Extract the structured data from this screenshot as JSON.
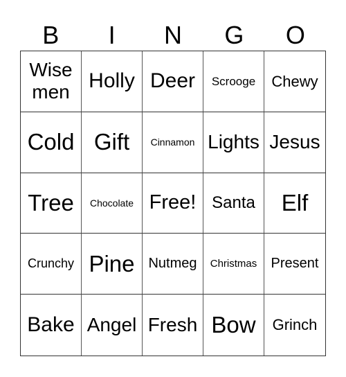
{
  "header": [
    "B",
    "I",
    "N",
    "G",
    "O"
  ],
  "cells": [
    "Wise men",
    "Holly",
    "Deer",
    "Scrooge",
    "Chewy",
    "Cold",
    "Gift",
    "Cinnamon",
    "Lights",
    "Jesus",
    "Tree",
    "Chocolate",
    "Free!",
    "Santa",
    "Elf",
    "Crunchy",
    "Pine",
    "Nutmeg",
    "Christmas",
    "Present",
    "Bake",
    "Angel",
    "Fresh",
    "Bow",
    "Grinch"
  ]
}
